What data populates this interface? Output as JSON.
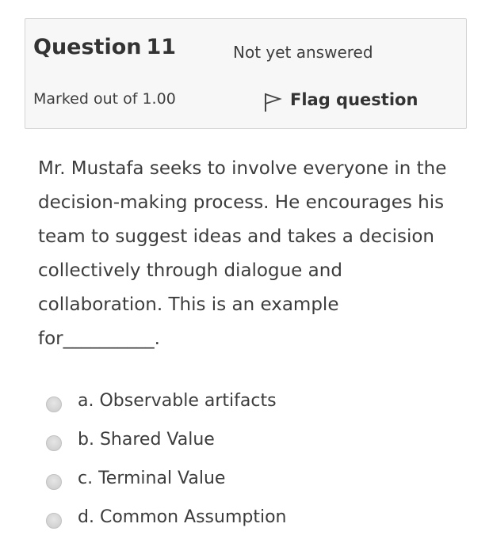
{
  "question_info": {
    "title_label": "Question",
    "number": "11",
    "state": "Not yet answered",
    "grade": "Marked out of 1.00",
    "flag_label": "Flag question",
    "flag_icon": "flag-outline-icon"
  },
  "question": {
    "lines": [
      "Mr. Mustafa seeks to involve everyone in the",
      "decision-making process. He encourages his",
      "team to suggest ideas and takes a decision",
      "collectively through dialogue and",
      "collaboration. This is an example",
      "for__________."
    ]
  },
  "answers": [
    {
      "label": "a. Observable artifacts",
      "selected": false
    },
    {
      "label": "b. Shared Value",
      "selected": false
    },
    {
      "label": "c. Terminal Value",
      "selected": false
    },
    {
      "label": "d. Common Assumption",
      "selected": false
    }
  ],
  "colors": {
    "info_box_background": "#f7f7f7",
    "info_box_border": "#d4d4d4",
    "text": "#3c3c3c",
    "radio": "#d2d2d2"
  }
}
